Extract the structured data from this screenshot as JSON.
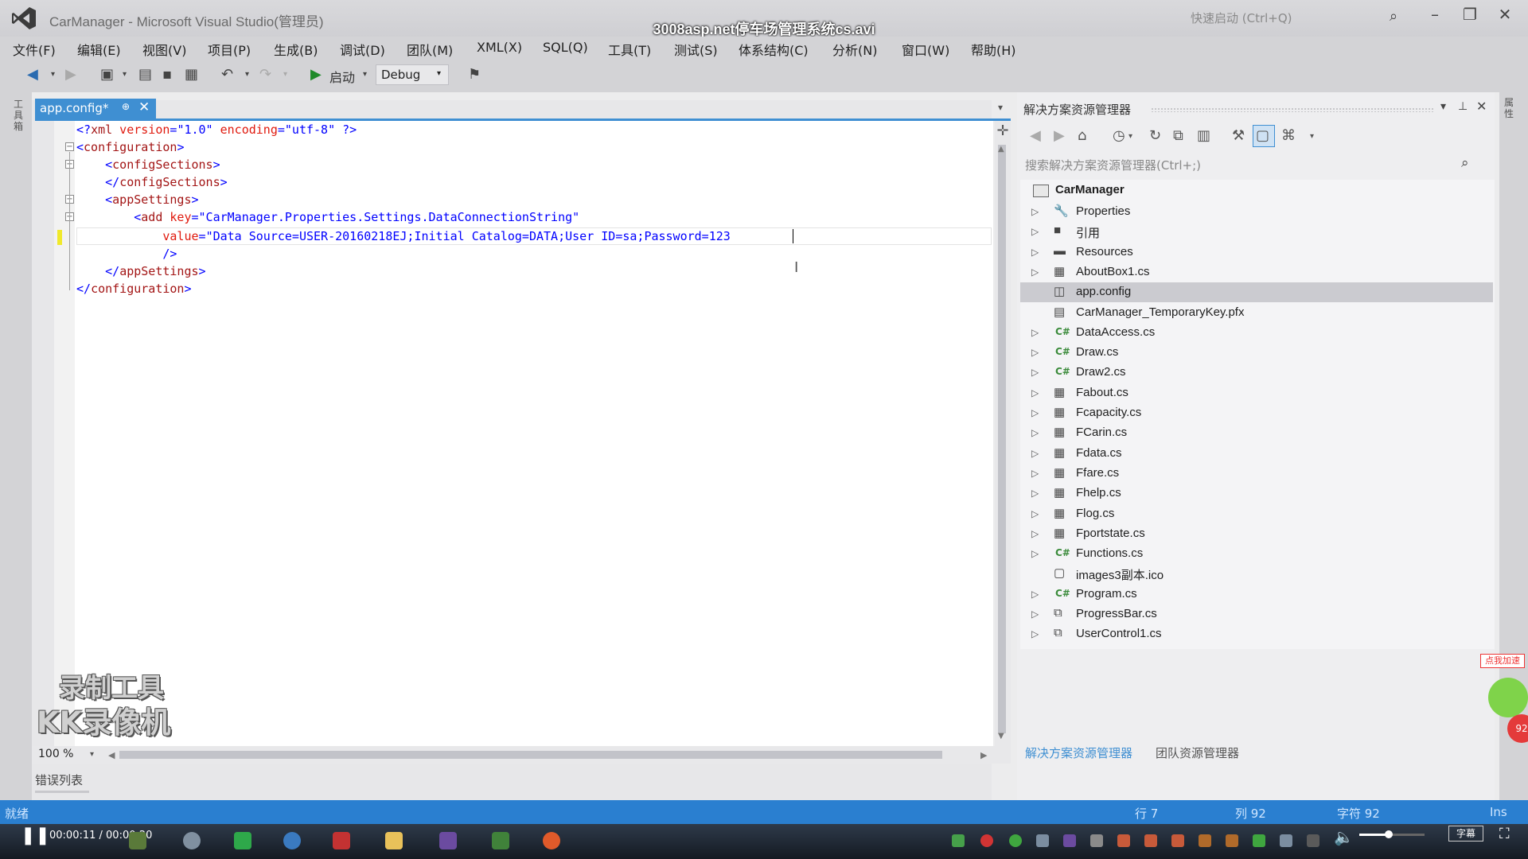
{
  "window": {
    "title": "CarManager - Microsoft Visual Studio(管理员)",
    "video_title": "3008asp.net停车场管理系统cs.avi",
    "quick_launch": "快速启动 (Ctrl+Q)"
  },
  "menu": [
    "文件(F)",
    "编辑(E)",
    "视图(V)",
    "项目(P)",
    "生成(B)",
    "调试(D)",
    "团队(M)",
    "XML(X)",
    "SQL(Q)",
    "工具(T)",
    "测试(S)",
    "体系结构(C)",
    "分析(N)",
    "窗口(W)",
    "帮助(H)"
  ],
  "toolbar": {
    "start_label": "启动",
    "config": "Debug"
  },
  "left_strip": {
    "label": "工具箱"
  },
  "editor": {
    "tab_label": "app.config*",
    "zoom": "100 %",
    "error_list_tab": "错误列表",
    "lines": [
      {
        "parts": [
          [
            "punc",
            "<?"
          ],
          [
            "tag",
            "xml"
          ],
          [
            "attr",
            " version"
          ],
          [
            "punc",
            "="
          ],
          [
            "val",
            "\"1.0\""
          ],
          [
            "attr",
            " encoding"
          ],
          [
            "punc",
            "="
          ],
          [
            "val",
            "\"utf-8\""
          ],
          [
            "punc",
            " ?>"
          ]
        ]
      },
      {
        "parts": [
          [
            "punc",
            "<"
          ],
          [
            "tag",
            "configuration"
          ],
          [
            "punc",
            ">"
          ]
        ]
      },
      {
        "parts": [
          [
            "punc",
            "    <"
          ],
          [
            "tag",
            "configSections"
          ],
          [
            "punc",
            ">"
          ]
        ]
      },
      {
        "parts": [
          [
            "punc",
            "    </"
          ],
          [
            "tag",
            "configSections"
          ],
          [
            "punc",
            ">"
          ]
        ]
      },
      {
        "parts": [
          [
            "punc",
            "    <"
          ],
          [
            "tag",
            "appSettings"
          ],
          [
            "punc",
            ">"
          ]
        ]
      },
      {
        "parts": [
          [
            "punc",
            "        <"
          ],
          [
            "tag",
            "add"
          ],
          [
            "attr",
            " key"
          ],
          [
            "punc",
            "="
          ],
          [
            "val",
            "\"CarManager.Properties.Settings.DataConnectionString\""
          ]
        ]
      },
      {
        "parts": [
          [
            "attr",
            "            value"
          ],
          [
            "punc",
            "="
          ],
          [
            "val",
            "\"Data Source=USER-20160218EJ;Initial Catalog=DATA;User ID=sa;Password=123"
          ]
        ]
      },
      {
        "parts": [
          [
            "punc",
            "            />"
          ]
        ]
      },
      {
        "parts": [
          [
            "punc",
            "    </"
          ],
          [
            "tag",
            "appSettings"
          ],
          [
            "punc",
            ">"
          ]
        ]
      },
      {
        "parts": [
          [
            "punc",
            "</"
          ],
          [
            "tag",
            "configuration"
          ],
          [
            "punc",
            ">"
          ]
        ]
      }
    ]
  },
  "solution_explorer": {
    "title": "解决方案资源管理器",
    "search_placeholder": "搜索解决方案资源管理器(Ctrl+;)",
    "project": "CarManager",
    "items": [
      {
        "label": "Properties",
        "icon": "wrench-icon",
        "expandable": true
      },
      {
        "label": "引用",
        "icon": "references-icon",
        "expandable": true
      },
      {
        "label": "Resources",
        "icon": "folder-icon",
        "expandable": true
      },
      {
        "label": "AboutBox1.cs",
        "icon": "form-icon",
        "expandable": true
      },
      {
        "label": "app.config",
        "icon": "config-icon",
        "expandable": false,
        "selected": true
      },
      {
        "label": "CarManager_TemporaryKey.pfx",
        "icon": "key-file-icon",
        "expandable": false
      },
      {
        "label": "DataAccess.cs",
        "icon": "csharp-icon",
        "expandable": true
      },
      {
        "label": "Draw.cs",
        "icon": "csharp-icon",
        "expandable": true
      },
      {
        "label": "Draw2.cs",
        "icon": "csharp-icon",
        "expandable": true
      },
      {
        "label": "Fabout.cs",
        "icon": "form-icon",
        "expandable": true
      },
      {
        "label": "Fcapacity.cs",
        "icon": "form-icon",
        "expandable": true
      },
      {
        "label": "FCarin.cs",
        "icon": "form-icon",
        "expandable": true
      },
      {
        "label": "Fdata.cs",
        "icon": "form-icon",
        "expandable": true
      },
      {
        "label": "Ffare.cs",
        "icon": "form-icon",
        "expandable": true
      },
      {
        "label": "Fhelp.cs",
        "icon": "form-icon",
        "expandable": true
      },
      {
        "label": "Flog.cs",
        "icon": "form-icon",
        "expandable": true
      },
      {
        "label": "Fportstate.cs",
        "icon": "form-icon",
        "expandable": true
      },
      {
        "label": "Functions.cs",
        "icon": "csharp-icon",
        "expandable": true
      },
      {
        "label": "images3副本.ico",
        "icon": "ico-file-icon",
        "expandable": false
      },
      {
        "label": "Program.cs",
        "icon": "csharp-icon",
        "expandable": true
      },
      {
        "label": "ProgressBar.cs",
        "icon": "usercontrol-icon",
        "expandable": true
      },
      {
        "label": "UserControl1.cs",
        "icon": "usercontrol-icon",
        "expandable": true
      }
    ],
    "bottom_tabs": [
      "解决方案资源管理器",
      "团队资源管理器"
    ]
  },
  "right_strip": {
    "label": "属性"
  },
  "watermark": {
    "line1": "录制工具",
    "line2": "KK录像机"
  },
  "speed_badge": "点我加速",
  "speed_value": "92",
  "statusbar": {
    "ready": "就绪",
    "line": "行 7",
    "col": "列 92",
    "char": "字符 92",
    "mode": "Ins"
  },
  "player": {
    "time": "00:00:11 / 00:00:20",
    "subtitle_btn": "字幕",
    "volume": 0.45
  }
}
